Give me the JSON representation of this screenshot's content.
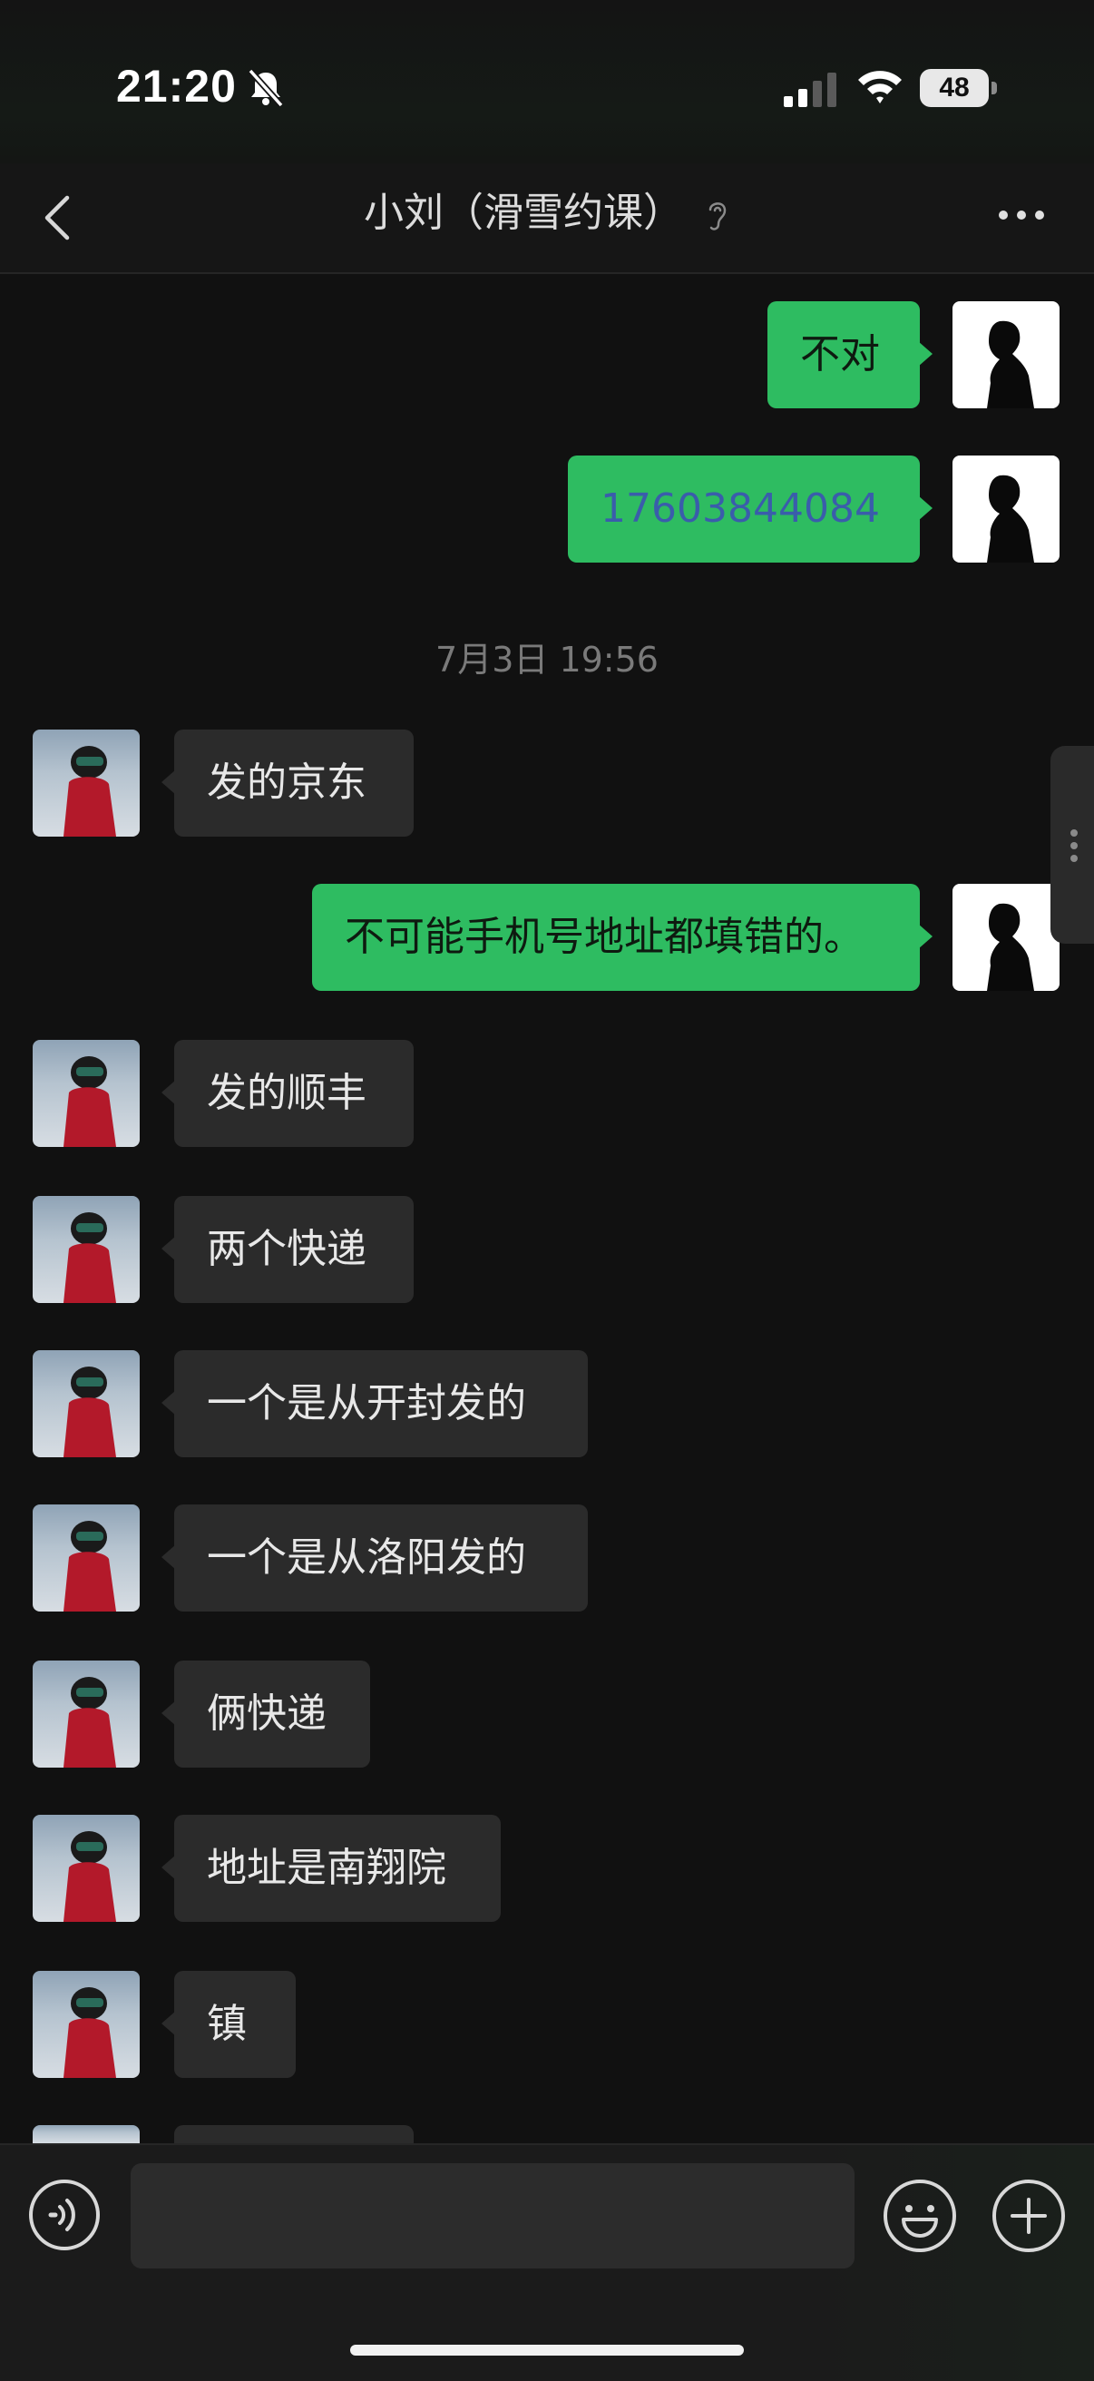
{
  "status_bar": {
    "time": "21:20",
    "battery": "48",
    "icons": [
      "bell-slash-icon",
      "cellular-signal-icon",
      "wifi-icon",
      "battery-icon"
    ]
  },
  "nav": {
    "title": "小刘（滑雪约课）",
    "icons": [
      "chevron-left-icon",
      "ear-icon",
      "more-icon"
    ]
  },
  "messages": [
    {
      "from": "me",
      "text": "不对"
    },
    {
      "from": "me",
      "text": "17603844084"
    },
    {
      "from": "her",
      "text": "发的京东"
    },
    {
      "from": "me",
      "text": "不可能手机号地址都填错的。"
    },
    {
      "from": "her",
      "text": "发的顺丰"
    },
    {
      "from": "her",
      "text": "两个快递"
    },
    {
      "from": "her",
      "text": "一个是从开封发的"
    },
    {
      "from": "her",
      "text": "一个是从洛阳发的"
    },
    {
      "from": "her",
      "text": "俩快递"
    },
    {
      "from": "her",
      "text": "地址是南翔院"
    },
    {
      "from": "her",
      "text": "镇"
    }
  ],
  "timestamp": "7月3日 19:56",
  "colors": {
    "outgoing_bubble": "#2ebc61",
    "incoming_bubble": "#2b2b2b",
    "background": "#111111",
    "phone_link": "#3a5dab"
  },
  "input_bar": {
    "placeholder": "",
    "icons": [
      "voice-icon",
      "emoji-icon",
      "plus-icon"
    ]
  }
}
